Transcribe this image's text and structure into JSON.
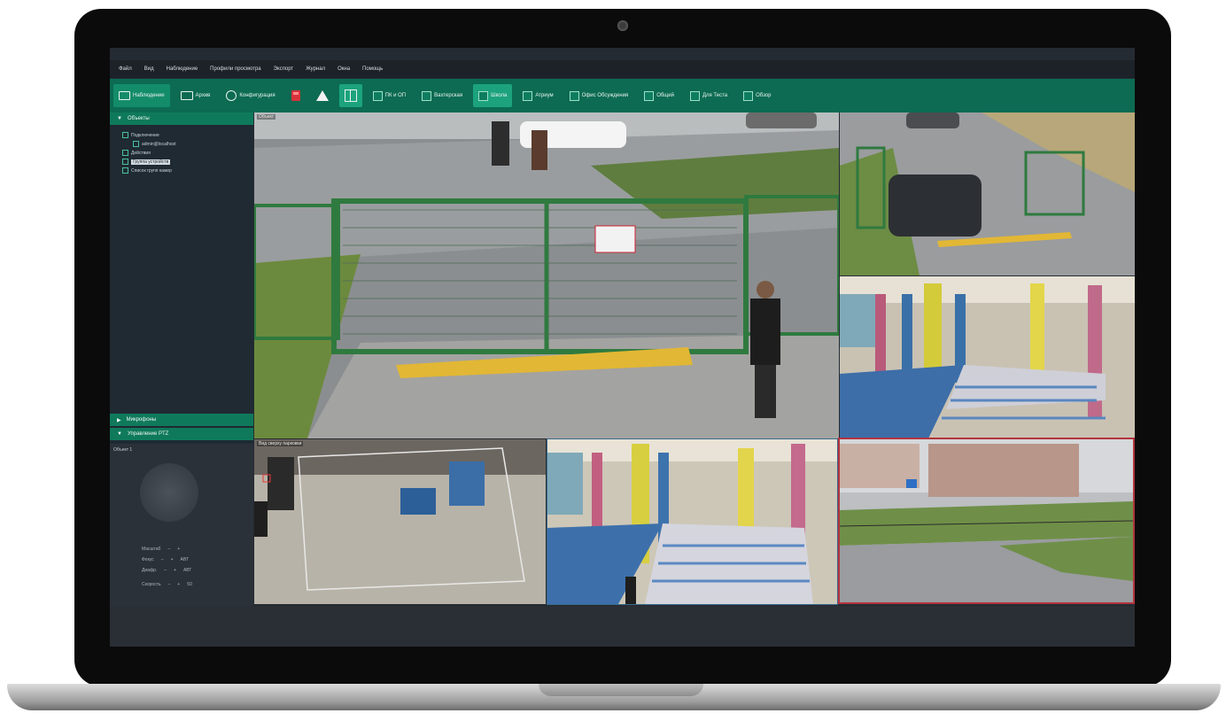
{
  "menu": [
    "Файл",
    "Вид",
    "Наблюдение",
    "Профили просмотра",
    "Экспорт",
    "Журнал",
    "Окна",
    "Помощь"
  ],
  "toolbar": {
    "main": [
      {
        "label": "Наблюдение",
        "icon": "monitor-icon"
      },
      {
        "label": "Архив",
        "icon": "folder-icon"
      },
      {
        "label": "Конфигурация",
        "icon": "gear-icon"
      }
    ],
    "layouts": [
      "ПК и ОП",
      "Вахтерская",
      "Школа",
      "Атриум",
      "Офис Обсуждения",
      "Общий",
      "Для Теста",
      "Обзор"
    ]
  },
  "sidebar": {
    "objects_title": "Объекты",
    "tree": [
      "Подключения",
      "admin@localhost",
      "Действия",
      "Группа устройств",
      "Список групп камер"
    ],
    "microphones_title": "Микрофоны",
    "ptz_title": "Управление PTZ",
    "ptz_camera": "Объект 1",
    "ptz_rows": [
      {
        "label": "Масштаб",
        "minus": "–",
        "plus": "+",
        "value": ""
      },
      {
        "label": "Фокус",
        "minus": "–",
        "plus": "+",
        "value": "АВТ"
      },
      {
        "label": "Диафр.",
        "minus": "–",
        "plus": "+",
        "value": "АВТ"
      },
      {
        "label": "Скорость",
        "minus": "–",
        "plus": "+",
        "value": "50"
      }
    ]
  },
  "cameras": [
    {
      "label": "Объект"
    },
    {
      "label": ""
    },
    {
      "label": ""
    },
    {
      "label": "Вид сверху парковки"
    },
    {
      "label": ""
    },
    {
      "label": ""
    }
  ],
  "colors": {
    "accent": "#0c6b52",
    "active": "#1ca37d",
    "alarm": "#d9323a",
    "selected_frame": "#b3333d"
  }
}
